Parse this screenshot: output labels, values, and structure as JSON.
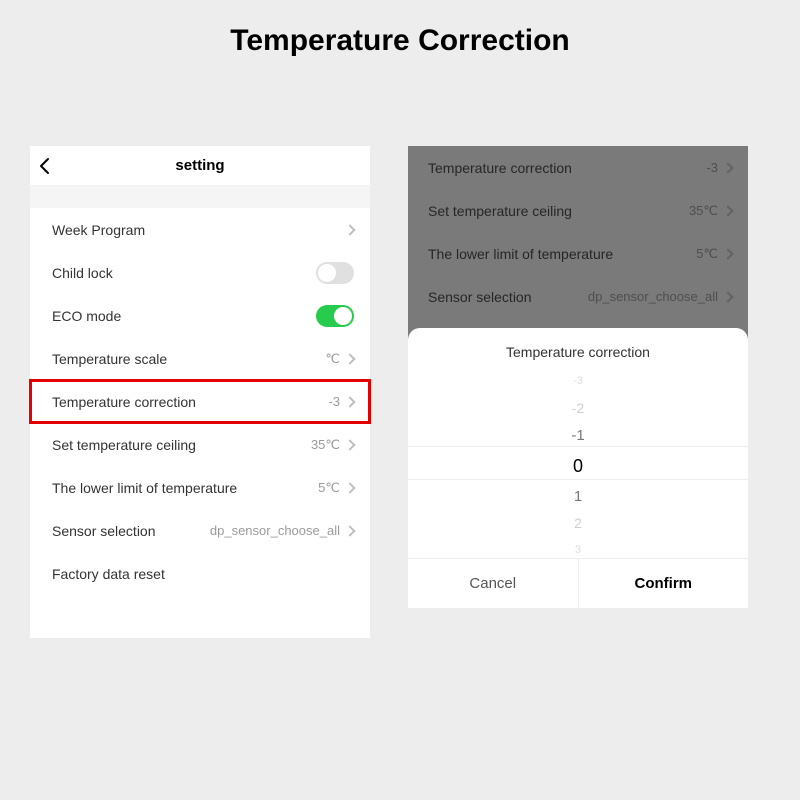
{
  "page_title": "Temperature Correction",
  "left": {
    "topbar_title": "setting",
    "rows": {
      "week_program": "Week Program",
      "child_lock": "Child lock",
      "eco_mode": "ECO mode",
      "temp_scale_label": "Temperature scale",
      "temp_scale_value": "℃",
      "temp_corr_label": "Temperature correction",
      "temp_corr_value": "-3",
      "ceiling_label": "Set temperature ceiling",
      "ceiling_value": "35℃",
      "lower_label": "The lower limit of temperature",
      "lower_value": "5℃",
      "sensor_label": "Sensor selection",
      "sensor_value": "dp_sensor_choose_all",
      "factory_reset": "Factory data reset"
    }
  },
  "right": {
    "bg": {
      "temp_corr_label": "Temperature correction",
      "temp_corr_value": "-3",
      "ceiling_label": "Set temperature ceiling",
      "ceiling_value": "35℃",
      "lower_label": "The lower limit of temperature",
      "lower_value": "5℃",
      "sensor_label": "Sensor selection",
      "sensor_value": "dp_sensor_choose_all"
    },
    "sheet": {
      "title": "Temperature correction",
      "picker": {
        "m3": "-3",
        "m2": "-2",
        "m1": "-1",
        "zero": "0",
        "p1": "1",
        "p2": "2",
        "p3": "3"
      },
      "cancel": "Cancel",
      "confirm": "Confirm"
    }
  }
}
